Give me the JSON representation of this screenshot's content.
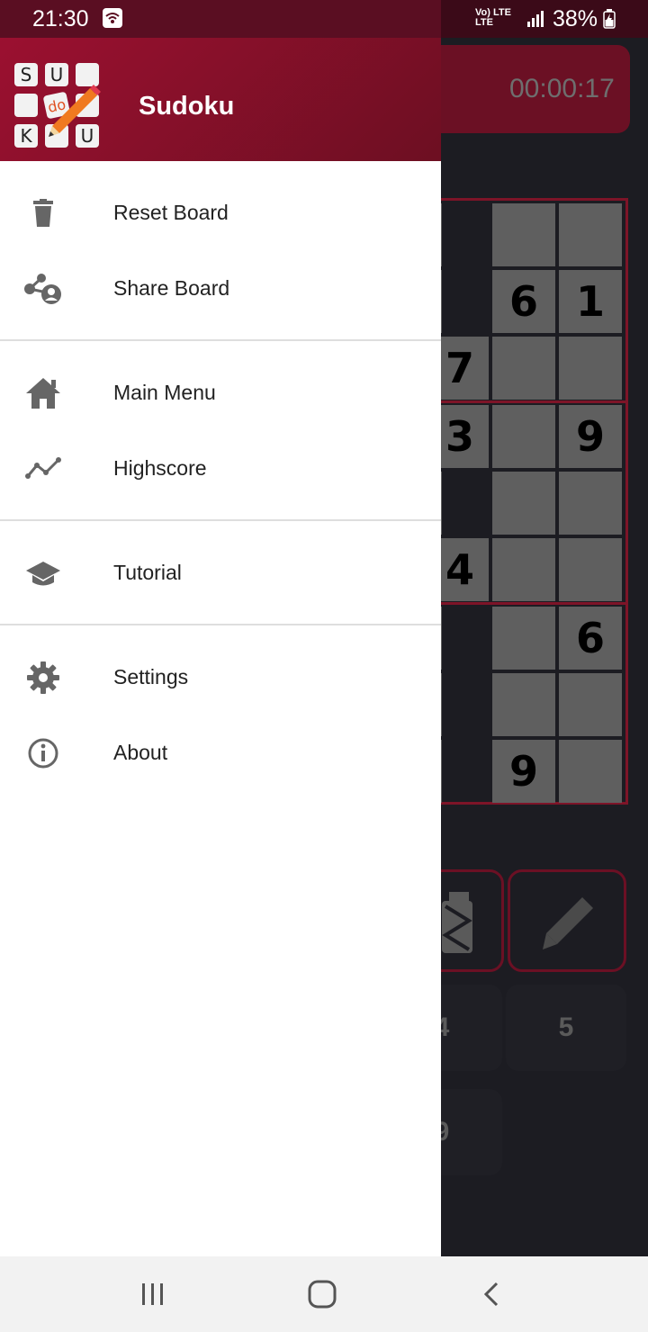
{
  "status_bar": {
    "time": "21:30",
    "network_top": "Vo) LTE",
    "network_bottom": "LTE",
    "battery": "38%"
  },
  "app": {
    "title": "Sudoku",
    "logo_letters": [
      "S",
      "U",
      "",
      "",
      "do",
      "",
      "K",
      "",
      "U"
    ]
  },
  "game": {
    "timer": "00:00:17",
    "visible_cells": [
      [
        "",
        "",
        ""
      ],
      [
        "",
        "6",
        "1"
      ],
      [
        "7",
        "",
        ""
      ],
      [
        "3",
        "",
        "9"
      ],
      [
        "",
        "",
        ""
      ],
      [
        "4",
        "",
        ""
      ],
      [
        "",
        "",
        "6"
      ],
      [
        "",
        "",
        ""
      ],
      [
        "",
        "9",
        ""
      ]
    ],
    "number_buttons": [
      "4",
      "5",
      "9"
    ]
  },
  "menu": {
    "sections": [
      {
        "items": [
          {
            "label": "Reset Board",
            "icon": "trash-icon"
          },
          {
            "label": "Share Board",
            "icon": "share-icon"
          }
        ]
      },
      {
        "items": [
          {
            "label": "Main Menu",
            "icon": "home-icon"
          },
          {
            "label": "Highscore",
            "icon": "trending-icon"
          }
        ]
      },
      {
        "items": [
          {
            "label": "Tutorial",
            "icon": "school-icon"
          }
        ]
      },
      {
        "items": [
          {
            "label": "Settings",
            "icon": "gear-icon"
          },
          {
            "label": "About",
            "icon": "info-icon"
          }
        ]
      }
    ]
  },
  "colors": {
    "accent": "#8b1028",
    "header_dark": "#6d0f22",
    "icon_gray": "#666666",
    "text": "#222222"
  }
}
